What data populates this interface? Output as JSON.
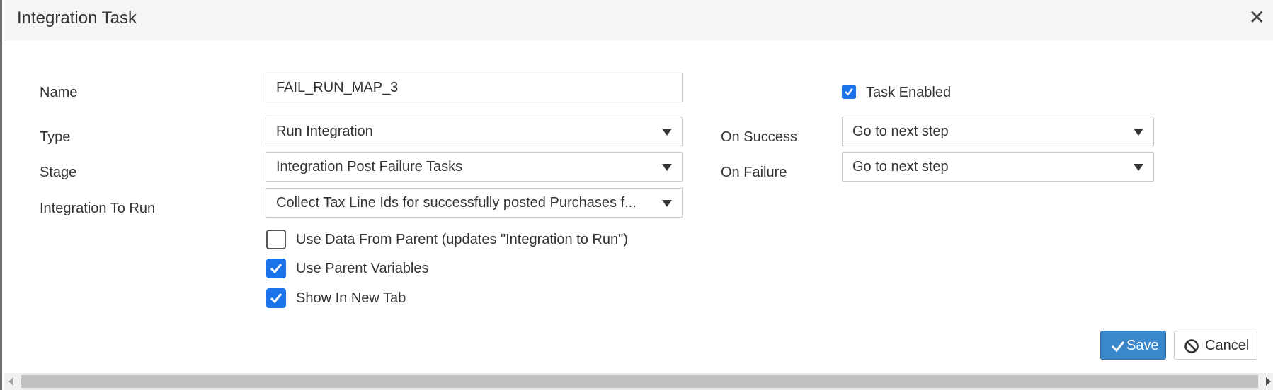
{
  "dialog": {
    "title": "Integration Task",
    "close_icon": "close-icon"
  },
  "form": {
    "name": {
      "label": "Name",
      "value": "FAIL_RUN_MAP_3"
    },
    "type": {
      "label": "Type",
      "value": "Run Integration"
    },
    "stage": {
      "label": "Stage",
      "value": "Integration Post Failure Tasks"
    },
    "integration_to_run": {
      "label": "Integration To Run",
      "value": "Collect Tax Line Ids for successfully posted Purchases f..."
    },
    "use_data_from_parent": {
      "label": "Use Data From Parent (updates \"Integration to Run\")",
      "checked": false
    },
    "use_parent_variables": {
      "label": "Use Parent Variables",
      "checked": true
    },
    "show_in_new_tab": {
      "label": "Show In New Tab",
      "checked": true
    },
    "task_enabled": {
      "label": "Task Enabled",
      "checked": true
    },
    "on_success": {
      "label": "On Success",
      "value": "Go to next step"
    },
    "on_failure": {
      "label": "On Failure",
      "value": "Go to next step"
    }
  },
  "buttons": {
    "save": "Save",
    "cancel": "Cancel"
  },
  "colors": {
    "accent": "#1a73e8",
    "save_bg": "#3a87cc"
  }
}
